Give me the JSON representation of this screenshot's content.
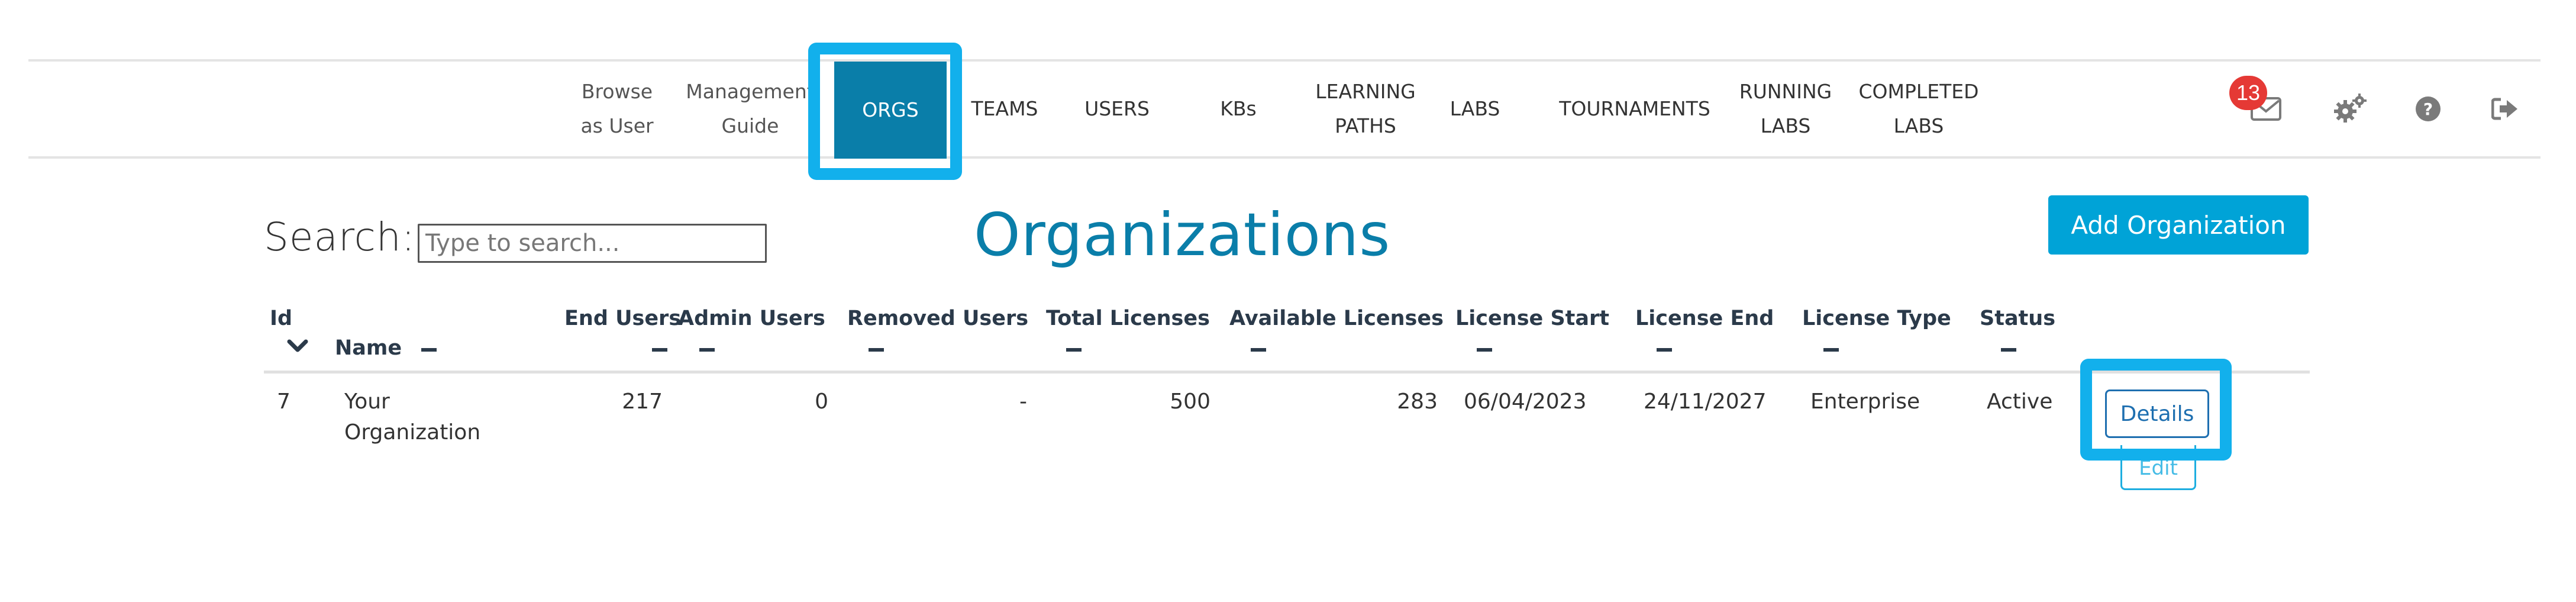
{
  "nav": {
    "items": [
      {
        "label1": "Browse",
        "label2": "as User"
      },
      {
        "label1": "Management",
        "label2": "Guide"
      },
      {
        "label1": "ORGS",
        "label2": ""
      },
      {
        "label1": "TEAMS",
        "label2": ""
      },
      {
        "label1": "USERS",
        "label2": ""
      },
      {
        "label1": "KBs",
        "label2": ""
      },
      {
        "label1": "LEARNING",
        "label2": "PATHS"
      },
      {
        "label1": "LABS",
        "label2": ""
      },
      {
        "label1": "TOURNAMENTS",
        "label2": ""
      },
      {
        "label1": "RUNNING",
        "label2": "LABS"
      },
      {
        "label1": "COMPLETED",
        "label2": "LABS"
      }
    ],
    "active": "ORGS",
    "mail_badge": "13",
    "icons": [
      "mail-icon",
      "gears-icon",
      "help-icon",
      "logout-icon"
    ]
  },
  "toolbar": {
    "search_label": "Search:",
    "search_placeholder": "Type to search...",
    "page_title": "Organizations",
    "add_button": "Add Organization"
  },
  "table": {
    "headers": {
      "id": "Id",
      "name": "Name",
      "end_users": "End Users",
      "admin_users": "Admin Users",
      "removed_users": "Removed Users",
      "total_licenses": "Total Licenses",
      "available_licenses": "Available Licenses",
      "license_start": "License Start",
      "license_end": "License End",
      "license_type": "License Type",
      "status": "Status"
    },
    "rows": [
      {
        "id": "7",
        "name1": "Your",
        "name2": "Organization",
        "end_users": "217",
        "admin_users": "0",
        "removed_users": "-",
        "total_licenses": "500",
        "available_licenses": "283",
        "license_start": "06/04/2023",
        "license_end": "24/11/2027",
        "license_type": "Enterprise",
        "status": "Active",
        "details": "Details",
        "edit": "Edit"
      }
    ]
  },
  "colors": {
    "accent": "#0a7ea9",
    "button": "#00a3d7",
    "highlight": "#12b0ec",
    "badge": "#e53935"
  }
}
